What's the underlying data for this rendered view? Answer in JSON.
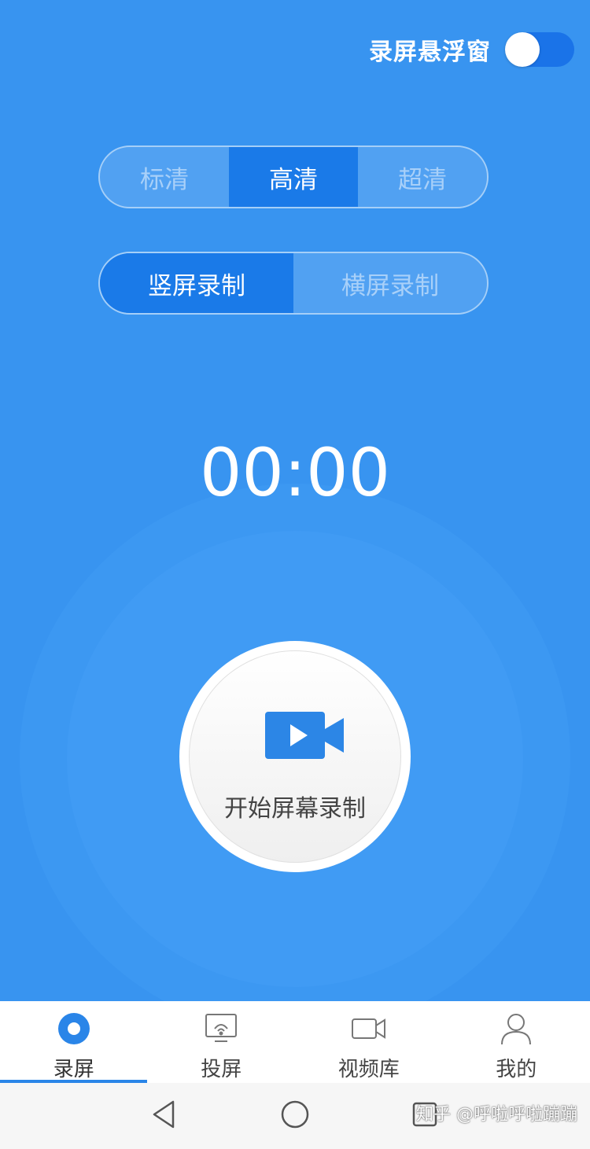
{
  "header": {
    "float_label": "录屏悬浮窗",
    "float_enabled": true
  },
  "quality": {
    "options": [
      "标清",
      "高清",
      "超清"
    ],
    "selected": "高清"
  },
  "orientation": {
    "options": [
      "竖屏录制",
      "横屏录制"
    ],
    "selected": "竖屏录制"
  },
  "timer": "00:00",
  "record_button": {
    "label": "开始屏幕录制",
    "icon": "video-camera-play-icon"
  },
  "tabs": [
    {
      "label": "录屏",
      "icon": "record-icon",
      "active": true
    },
    {
      "label": "投屏",
      "icon": "cast-screen-icon",
      "active": false
    },
    {
      "label": "视频库",
      "icon": "video-library-icon",
      "active": false
    },
    {
      "label": "我的",
      "icon": "profile-icon",
      "active": false
    }
  ],
  "system_nav": {
    "icons": [
      "back-icon",
      "home-icon",
      "recents-icon"
    ]
  },
  "watermark": "知乎 @呼啦呼啦蹦蹦",
  "colors": {
    "background": "#3894f0",
    "accent": "#1a7ae8",
    "tab_active": "#2a85e8"
  }
}
